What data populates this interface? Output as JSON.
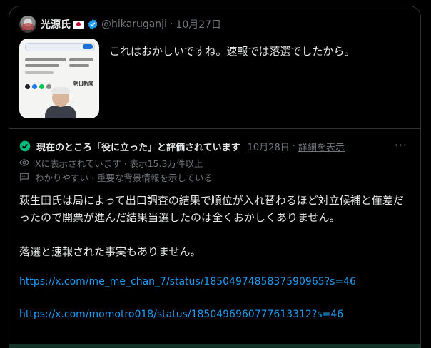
{
  "quoted_post": {
    "display_name": "光源氏",
    "handle": "@hikaruganji",
    "separator": "·",
    "date": "10月27日",
    "text": "これはおかしいですね。速報では落選でしたから。",
    "thumbnail": {
      "logo_text": "朝日新聞"
    }
  },
  "note": {
    "title": "現在のところ「役に立った」と評価されています",
    "date": "10月28日",
    "separator": "·",
    "details_link": "詳細を表示",
    "visibility": "Xに表示されています · 表示15.3万件以上",
    "reason": "わかりやすい · 重要な背景情報を示している",
    "paragraph1": "萩生田氏は局によって出口調査の結果で順位が入れ替わるほど対立候補と僅差だったので開票が進んだ結果当選したのは全くおかしくありません。",
    "paragraph2": "落選と速報された事実もありません。",
    "links": [
      "https://x.com/me_me_chan_7/status/1850497485837590965?s=46",
      "https://x.com/momotro018/status/1850496960777613312?s=46"
    ]
  },
  "colors": {
    "background": "#000000",
    "text": "#e7e9ea",
    "muted": "#71767b",
    "link": "#1d9bf0",
    "verified": "#1d9bf0",
    "helpful_check": "#00ba7c",
    "border": "#2f3336"
  }
}
